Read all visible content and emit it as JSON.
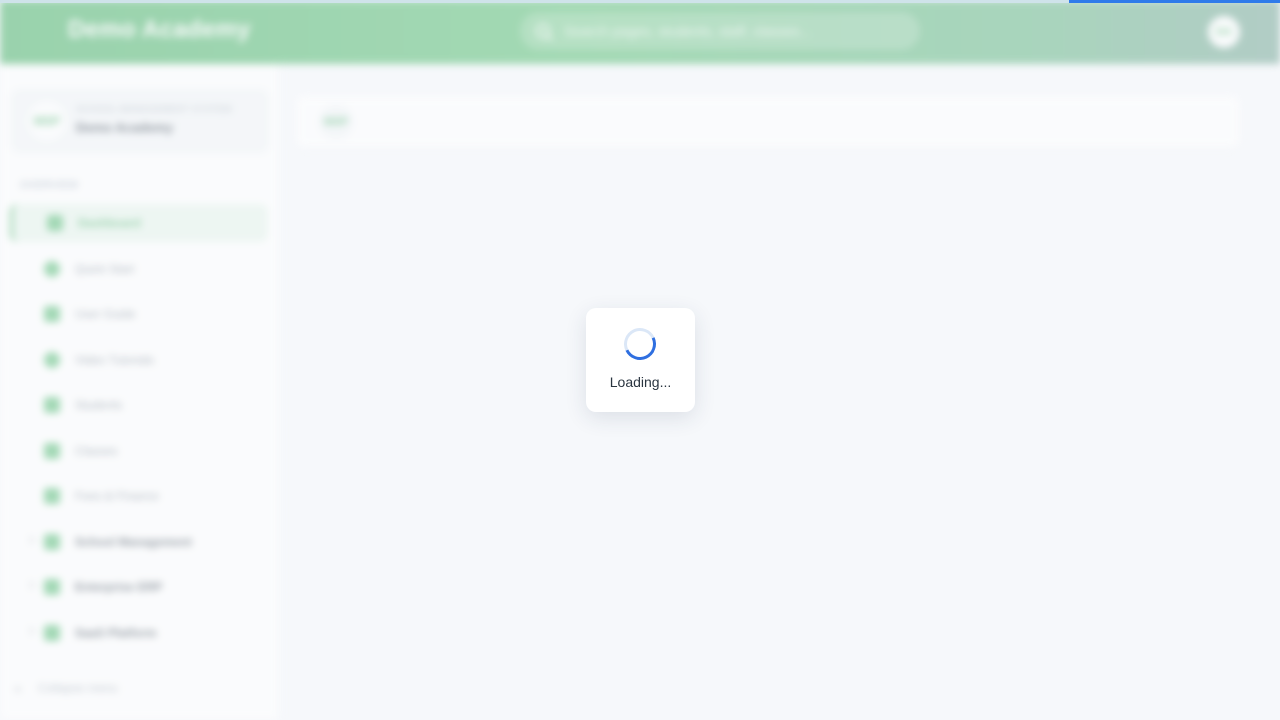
{
  "progress": {
    "percent": 16.5,
    "color": "#2f7bea"
  },
  "header": {
    "brand": "Demo Academy",
    "search_placeholder": "Search pages, students, staff, classes...",
    "avatar_initials": "DA"
  },
  "sidebar": {
    "org_label": "SCHOOL MANAGEMENT SYSTEM",
    "org_name": "Demo Academy",
    "org_logo": "MSP",
    "section_label": "OVERVIEW",
    "items": [
      {
        "label": "Dashboard",
        "icon": "home-icon",
        "active": true
      },
      {
        "label": "Quick Start",
        "icon": "rocket-icon"
      },
      {
        "label": "User Guide",
        "icon": "book-icon"
      },
      {
        "label": "Video Tutorials",
        "icon": "play-icon"
      },
      {
        "label": "Students",
        "icon": "student-icon"
      },
      {
        "label": "Classes",
        "icon": "classroom-icon"
      },
      {
        "label": "Fees & Finance",
        "icon": "wallet-icon"
      },
      {
        "label": "School Management",
        "icon": "building-icon",
        "expandable": true
      },
      {
        "label": "Enterprise ERP",
        "icon": "grid-icon",
        "expandable": true
      },
      {
        "label": "SaaS Platform",
        "icon": "cloud-icon",
        "expandable": true
      }
    ],
    "collapse_label": "Collapse menu"
  },
  "main": {
    "logo": "MSP"
  },
  "loader": {
    "text": "Loading..."
  },
  "colors": {
    "accent": "#4fb46e",
    "spinner": "#2f6fe0"
  }
}
